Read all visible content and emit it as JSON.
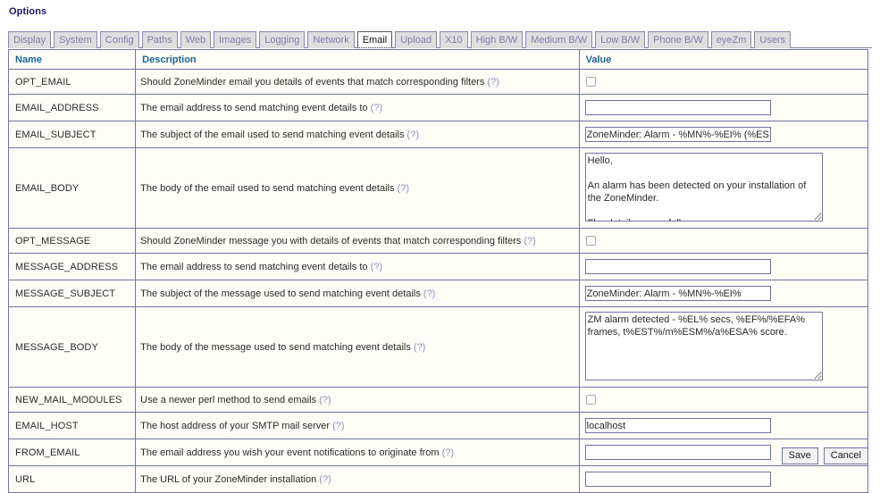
{
  "page": {
    "title": "Options"
  },
  "tabs": [
    {
      "label": "Display",
      "active": false
    },
    {
      "label": "System",
      "active": false
    },
    {
      "label": "Config",
      "active": false
    },
    {
      "label": "Paths",
      "active": false
    },
    {
      "label": "Web",
      "active": false
    },
    {
      "label": "Images",
      "active": false
    },
    {
      "label": "Logging",
      "active": false
    },
    {
      "label": "Network",
      "active": false
    },
    {
      "label": "Email",
      "active": true
    },
    {
      "label": "Upload",
      "active": false
    },
    {
      "label": "X10",
      "active": false
    },
    {
      "label": "High B/W",
      "active": false
    },
    {
      "label": "Medium B/W",
      "active": false
    },
    {
      "label": "Low B/W",
      "active": false
    },
    {
      "label": "Phone B/W",
      "active": false
    },
    {
      "label": "eyeZm",
      "active": false
    },
    {
      "label": "Users",
      "active": false
    }
  ],
  "table": {
    "headers": {
      "name": "Name",
      "description": "Description",
      "value": "Value"
    },
    "help_marker": "(?)",
    "rows": [
      {
        "name": "OPT_EMAIL",
        "description": "Should ZoneMinder email you details of events that match corresponding filters",
        "control": "checkbox",
        "checked": false,
        "value": ""
      },
      {
        "name": "EMAIL_ADDRESS",
        "description": "The email address to send matching event details to",
        "control": "text",
        "value": ""
      },
      {
        "name": "EMAIL_SUBJECT",
        "description": "The subject of the email used to send matching event details",
        "control": "text",
        "value": "ZoneMinder: Alarm - %MN%-%EI% (%ESM%)"
      },
      {
        "name": "EMAIL_BODY",
        "description": "The body of the email used to send matching event details",
        "control": "textarea-scroll",
        "value": "Hello,\n\nAn alarm has been detected on your installation of the ZoneMinder.\n\nThe details are as follows :-"
      },
      {
        "name": "OPT_MESSAGE",
        "description": "Should ZoneMinder message you with details of events that match corresponding filters",
        "control": "checkbox",
        "checked": false,
        "value": ""
      },
      {
        "name": "MESSAGE_ADDRESS",
        "description": "The email address to send matching event details to",
        "control": "text",
        "value": ""
      },
      {
        "name": "MESSAGE_SUBJECT",
        "description": "The subject of the message used to send matching event details",
        "control": "text",
        "value": "ZoneMinder: Alarm - %MN%-%EI%"
      },
      {
        "name": "MESSAGE_BODY",
        "description": "The body of the message used to send matching event details",
        "control": "textarea",
        "value": "ZM alarm detected - %EL% secs, %EF%/%EFA% frames, t%EST%/m%ESM%/a%ESA% score."
      },
      {
        "name": "NEW_MAIL_MODULES",
        "description": "Use a newer perl method to send emails",
        "control": "checkbox",
        "checked": false,
        "value": ""
      },
      {
        "name": "EMAIL_HOST",
        "description": "The host address of your SMTP mail server",
        "control": "text",
        "value": "localhost"
      },
      {
        "name": "FROM_EMAIL",
        "description": "The email address you wish your event notifications to originate from",
        "control": "text",
        "value": ""
      },
      {
        "name": "URL",
        "description": "The URL of your ZoneMinder installation",
        "control": "text",
        "value": ""
      }
    ]
  },
  "footer": {
    "save_label": "Save",
    "cancel_label": "Cancel"
  },
  "colors": {
    "title": "#16166c",
    "table_header_text": "#1a6496",
    "border": "#7272a8",
    "tab_inactive_text": "#7e7eb0",
    "tab_inactive_bg": "#dedede",
    "help_link": "#8e8ec4",
    "row_bg": "#fffdf6"
  }
}
